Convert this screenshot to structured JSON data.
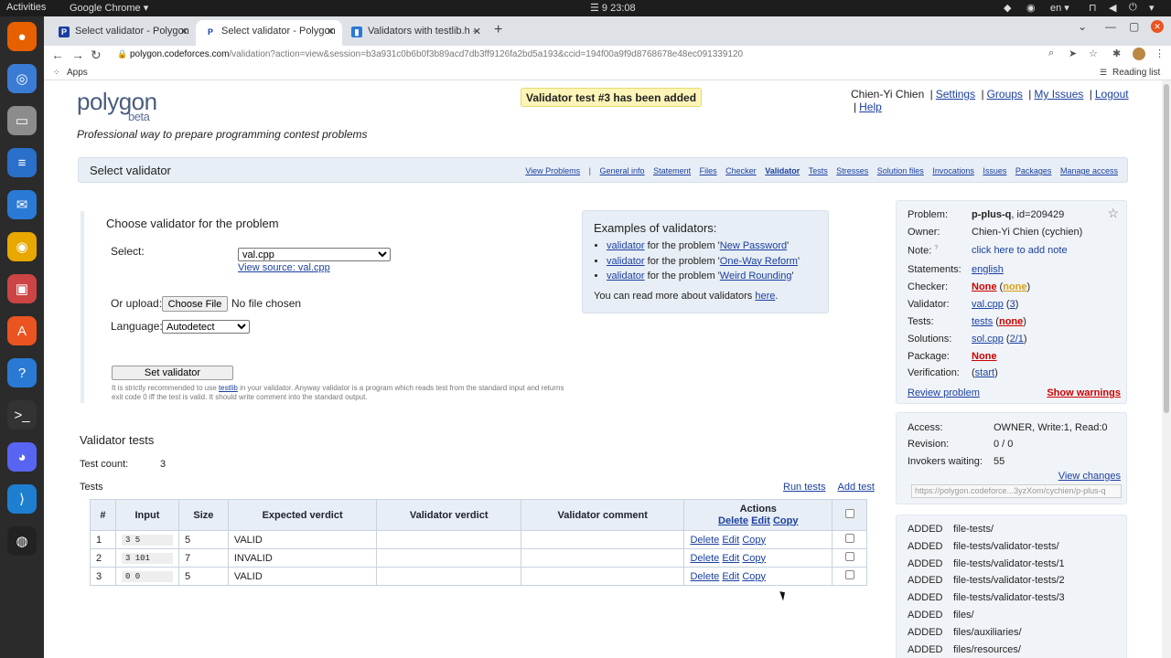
{
  "os": {
    "activities": "Activities",
    "app_menu": "Google Chrome ▾",
    "clock": "☰ 9 23:08",
    "lang": "en ▾",
    "dock_icons": [
      "firefox-icon",
      "chrome-icon",
      "files-icon",
      "writer-icon",
      "thunderbird-icon",
      "rhythmbox-icon",
      "image-viewer-icon",
      "software-icon",
      "help-icon",
      "terminal-icon",
      "discord-icon",
      "vscode-icon",
      "obs-icon"
    ]
  },
  "browser": {
    "tabs": [
      {
        "label": "Select validator - Polygon",
        "fav": "P"
      },
      {
        "label": "Select validator - Polygon",
        "fav": "P"
      },
      {
        "label": "Validators with testlib.h -",
        "fav": "▮"
      }
    ],
    "url_domain": "polygon.codeforces.com",
    "url_rest": "/validation?action=view&session=b3a931c0b6b0f3b89acd7db3ff9126fa2bd5a193&ccid=194f00a9f9d8768678e48ec091339120",
    "bookmarks_apps": "Apps",
    "reading_list": "Reading list"
  },
  "header": {
    "logo": "polygon",
    "beta": "beta",
    "tagline": "Professional way to prepare programming contest problems",
    "notice": "Validator test #3 has been added",
    "user": "Chien-Yi Chien",
    "links": [
      "Settings",
      "Groups",
      "My Issues",
      "Logout",
      "Help"
    ]
  },
  "menubar": {
    "title": "Select validator",
    "view_problems": "View Problems",
    "sep": "|",
    "links": [
      "General info",
      "Statement",
      "Files",
      "Checker",
      "Validator",
      "Tests",
      "Stresses",
      "Solution files",
      "Invocations",
      "Issues",
      "Packages",
      "Manage access"
    ]
  },
  "form": {
    "heading": "Choose validator for the problem",
    "select_label": "Select:",
    "select_value": "val.cpp",
    "view_source": "View source: val.cpp",
    "upload_label": "Or upload:",
    "choose_file": "Choose File",
    "no_file": "No file chosen",
    "language_label": "Language:",
    "language_value": "Autodetect",
    "set_validator": "Set validator",
    "note_pre": "It is strictly recommended to use ",
    "note_link": "testlib",
    "note_post": " in your validator. Anyway validator is a program which reads test from the standard input and returns exit code 0 iff the test is valid. It should write comment into the standard output."
  },
  "examples": {
    "title": "Examples of validators:",
    "items": [
      {
        "link": "validator",
        "mid": " for the problem '",
        "problem": "New Password",
        "end": "'"
      },
      {
        "link": "validator",
        "mid": " for the problem '",
        "problem": "One-Way Reform",
        "end": "'"
      },
      {
        "link": "validator",
        "mid": " for the problem '",
        "problem": "Weird Rounding",
        "end": "'"
      }
    ],
    "more_pre": "You can read more about validators ",
    "more_link": "here",
    "more_post": "."
  },
  "tests": {
    "heading": "Validator tests",
    "count_label": "Test count:",
    "count": "3",
    "tests_label": "Tests",
    "run_tests": "Run tests",
    "add_test": "Add test",
    "columns": [
      "#",
      "Input",
      "Size",
      "Expected verdict",
      "Validator verdict",
      "Validator comment",
      "Actions"
    ],
    "action_links": [
      "Delete",
      "Edit",
      "Copy"
    ],
    "rows": [
      {
        "num": "1",
        "input": "3 5",
        "size": "5",
        "expected": "VALID",
        "verdict": "",
        "comment": ""
      },
      {
        "num": "2",
        "input": "3 101",
        "size": "7",
        "expected": "INVALID",
        "verdict": "",
        "comment": ""
      },
      {
        "num": "3",
        "input": "0 0",
        "size": "5",
        "expected": "VALID",
        "verdict": "",
        "comment": ""
      }
    ]
  },
  "sidebar": {
    "problem_label": "Problem:",
    "problem_name": "p-plus-q",
    "problem_id": ", id=209429",
    "owner_label": "Owner:",
    "owner": "Chien-Yi Chien (cychien)",
    "note_label": "Note:",
    "note_q": "?",
    "note_link": "click here to add note",
    "statements_label": "Statements:",
    "statements": "english",
    "checker_label": "Checker:",
    "checker": "None",
    "checker_sub": "none",
    "validator_label": "Validator:",
    "validator": "val.cpp",
    "validator_count": "3",
    "tests_label": "Tests:",
    "tests": "tests",
    "tests_sub": "none",
    "solutions_label": "Solutions:",
    "solutions": "sol.cpp",
    "solutions_sub": "2/1",
    "package_label": "Package:",
    "package": "None",
    "verification_label": "Verification:",
    "verification": "start",
    "review": "Review problem",
    "warnings": "Show warnings",
    "access_label": "Access:",
    "access": "OWNER, Write:1, Read:0",
    "revision_label": "Revision:",
    "revision": "0 / 0",
    "invokers_label": "Invokers waiting:",
    "invokers": "55",
    "view_changes": "View changes",
    "repo_url": "https://polygon.codeforce...3yzXom/cychien/p-plus-q",
    "changes": [
      {
        "op": "ADDED",
        "path": "file-tests/"
      },
      {
        "op": "ADDED",
        "path": "file-tests/validator-tests/"
      },
      {
        "op": "ADDED",
        "path": "file-tests/validator-tests/1"
      },
      {
        "op": "ADDED",
        "path": "file-tests/validator-tests/2"
      },
      {
        "op": "ADDED",
        "path": "file-tests/validator-tests/3"
      },
      {
        "op": "ADDED",
        "path": "files/"
      },
      {
        "op": "ADDED",
        "path": "files/auxiliaries/"
      },
      {
        "op": "ADDED",
        "path": "files/resources/"
      }
    ]
  },
  "colors": {
    "link": "#1a3fa0",
    "red": "#cc0000",
    "notice_bg": "#fdf5b8",
    "panel": "#e8eef5"
  }
}
